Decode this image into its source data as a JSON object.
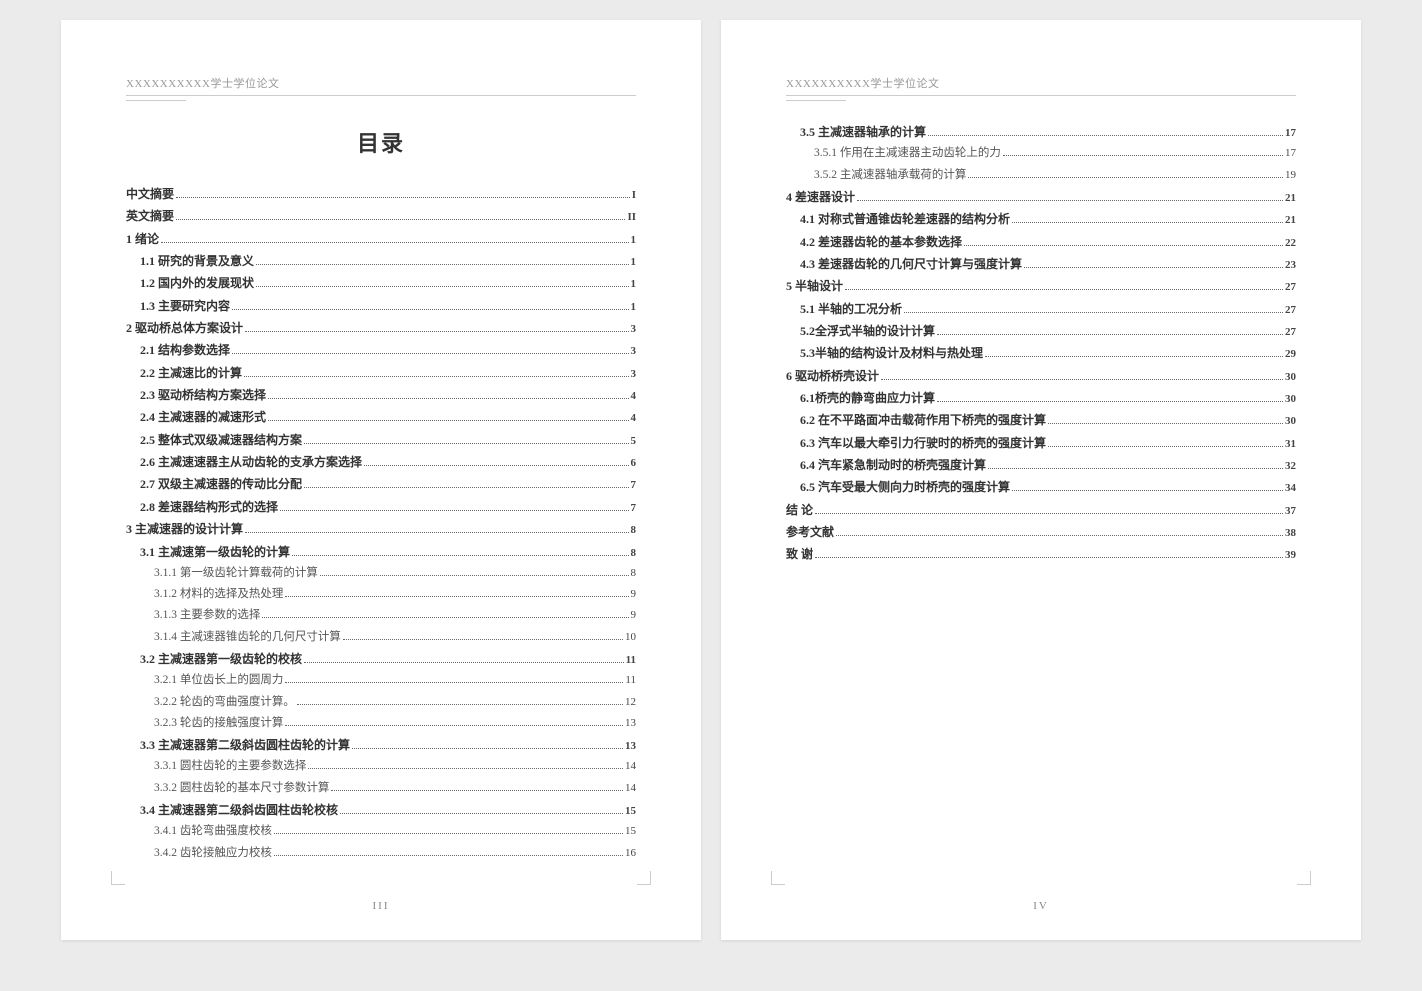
{
  "header": "XXXXXXXXXX学士学位论文",
  "toc_title": "目录",
  "page_num_left": "III",
  "page_num_right": "IV",
  "left_entries": [
    {
      "level": 0,
      "label": "中文摘要",
      "page": "I"
    },
    {
      "level": 0,
      "label": "英文摘要",
      "page": "II"
    },
    {
      "level": 0,
      "label": "1 绪论",
      "page": "1"
    },
    {
      "level": 1,
      "label": "1.1 研究的背景及意义",
      "page": "1"
    },
    {
      "level": 1,
      "label": "1.2 国内外的发展现状",
      "page": "1"
    },
    {
      "level": 1,
      "label": "1.3 主要研究内容",
      "page": "1"
    },
    {
      "level": 0,
      "label": "2 驱动桥总体方案设计",
      "page": "3"
    },
    {
      "level": 1,
      "label": "2.1 结构参数选择",
      "page": "3"
    },
    {
      "level": 1,
      "label": "2.2 主减速比的计算",
      "page": "3"
    },
    {
      "level": 1,
      "label": "2.3 驱动桥结构方案选择",
      "page": "4"
    },
    {
      "level": 1,
      "label": "2.4 主减速器的减速形式",
      "page": "4"
    },
    {
      "level": 1,
      "label": "2.5 整体式双级减速器结构方案",
      "page": "5"
    },
    {
      "level": 1,
      "label": "2.6 主减速速器主从动齿轮的支承方案选择",
      "page": "6"
    },
    {
      "level": 1,
      "label": "2.7 双级主减速器的传动比分配",
      "page": "7"
    },
    {
      "level": 1,
      "label": "2.8 差速器结构形式的选择",
      "page": "7"
    },
    {
      "level": 0,
      "label": "3 主减速器的设计计算",
      "page": "8"
    },
    {
      "level": 1,
      "label": "3.1 主减速第一级齿轮的计算",
      "page": "8"
    },
    {
      "level": 2,
      "label": "3.1.1 第一级齿轮计算载荷的计算",
      "page": "8"
    },
    {
      "level": 2,
      "label": "3.1.2 材料的选择及热处理",
      "page": "9"
    },
    {
      "level": 2,
      "label": "3.1.3 主要参数的选择",
      "page": "9"
    },
    {
      "level": 2,
      "label": "3.1.4 主减速器锥齿轮的几何尺寸计算",
      "page": "10"
    },
    {
      "level": 1,
      "label": "3.2 主减速器第一级齿轮的校核",
      "page": "11"
    },
    {
      "level": 2,
      "label": "3.2.1 单位齿长上的圆周力",
      "page": "11"
    },
    {
      "level": 2,
      "label": "3.2.2 轮齿的弯曲强度计算。",
      "page": "12"
    },
    {
      "level": 2,
      "label": "3.2.3 轮齿的接触强度计算",
      "page": "13"
    },
    {
      "level": 1,
      "label": "3.3 主减速器第二级斜齿圆柱齿轮的计算",
      "page": "13"
    },
    {
      "level": 2,
      "label": "3.3.1 圆柱齿轮的主要参数选择",
      "page": "14"
    },
    {
      "level": 2,
      "label": "3.3.2 圆柱齿轮的基本尺寸参数计算",
      "page": "14"
    },
    {
      "level": 1,
      "label": "3.4 主减速器第二级斜齿圆柱齿轮校核",
      "page": "15"
    },
    {
      "level": 2,
      "label": "3.4.1 齿轮弯曲强度校核",
      "page": "15"
    },
    {
      "level": 2,
      "label": "3.4.2 齿轮接触应力校核",
      "page": "16"
    }
  ],
  "right_entries": [
    {
      "level": 1,
      "label": "3.5 主减速器轴承的计算",
      "page": "17"
    },
    {
      "level": 2,
      "label": "3.5.1 作用在主减速器主动齿轮上的力",
      "page": "17"
    },
    {
      "level": 2,
      "label": "3.5.2 主减速器轴承载荷的计算",
      "page": "19"
    },
    {
      "level": 0,
      "label": "4 差速器设计",
      "page": "21"
    },
    {
      "level": 1,
      "label": "4.1 对称式普通锥齿轮差速器的结构分析",
      "page": "21"
    },
    {
      "level": 1,
      "label": "4.2 差速器齿轮的基本参数选择",
      "page": "22"
    },
    {
      "level": 1,
      "label": "4.3 差速器齿轮的几何尺寸计算与强度计算",
      "page": "23"
    },
    {
      "level": 0,
      "label": "5 半轴设计",
      "page": "27"
    },
    {
      "level": 1,
      "label": "5.1 半轴的工况分析",
      "page": "27"
    },
    {
      "level": 1,
      "label": "5.2全浮式半轴的设计计算",
      "page": "27"
    },
    {
      "level": 1,
      "label": "5.3半轴的结构设计及材料与热处理",
      "page": "29"
    },
    {
      "level": 0,
      "label": "6 驱动桥桥壳设计",
      "page": "30"
    },
    {
      "level": 1,
      "label": "6.1桥壳的静弯曲应力计算",
      "page": "30"
    },
    {
      "level": 1,
      "label": "6.2 在不平路面冲击载荷作用下桥壳的强度计算",
      "page": "30"
    },
    {
      "level": 1,
      "label": "6.3 汽车以最大牵引力行驶时的桥壳的强度计算",
      "page": "31"
    },
    {
      "level": 1,
      "label": "6.4 汽车紧急制动时的桥壳强度计算",
      "page": "32"
    },
    {
      "level": 1,
      "label": "6.5 汽车受最大侧向力时桥壳的强度计算",
      "page": "34"
    },
    {
      "level": 0,
      "label": "结    论",
      "page": "37"
    },
    {
      "level": 0,
      "label": "参考文献",
      "page": "38"
    },
    {
      "level": 0,
      "label": "致  谢",
      "page": "39"
    }
  ]
}
